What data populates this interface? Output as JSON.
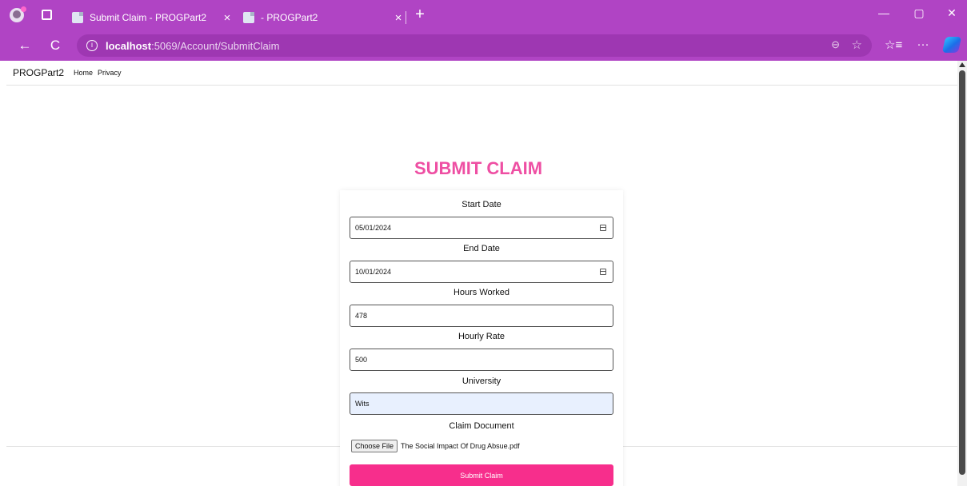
{
  "browser": {
    "tabs": [
      {
        "title": "Submit Claim - PROGPart2",
        "close": "×"
      },
      {
        "title": "- PROGPart2",
        "close": "×"
      }
    ],
    "new_tab": "+",
    "url_host": "localhost",
    "url_path": ":5069/Account/SubmitClaim",
    "window_controls": {
      "minimize": "—",
      "restore": "▢",
      "close": "✕"
    }
  },
  "icons": {
    "back": "←",
    "refresh": "C",
    "zoom": "⊖",
    "favorite": "☆",
    "favorites_bar": "☆≡",
    "more": "···",
    "info": "i"
  },
  "navbar": {
    "brand": "PROGPart2",
    "links": [
      "Home",
      "Privacy"
    ]
  },
  "page": {
    "heading": "SUBMIT CLAIM",
    "form": {
      "start_date_label": "Start Date",
      "start_date_value": "05/01/2024",
      "end_date_label": "End Date",
      "end_date_value": "10/01/2024",
      "hours_label": "Hours Worked",
      "hours_value": "478",
      "rate_label": "Hourly Rate",
      "rate_value": "500",
      "university_label": "University",
      "university_value": "Wits",
      "document_label": "Claim Document",
      "choose_file": "Choose File",
      "file_name": "The Social Impact Of Drug Absue.pdf",
      "submit_label": "Submit Claim"
    }
  },
  "colors": {
    "browser_accent": "#b044c4",
    "heading_pink": "#ee4fa3",
    "button_pink": "#f72e8c",
    "autofill_bg": "#e8f0fe"
  }
}
